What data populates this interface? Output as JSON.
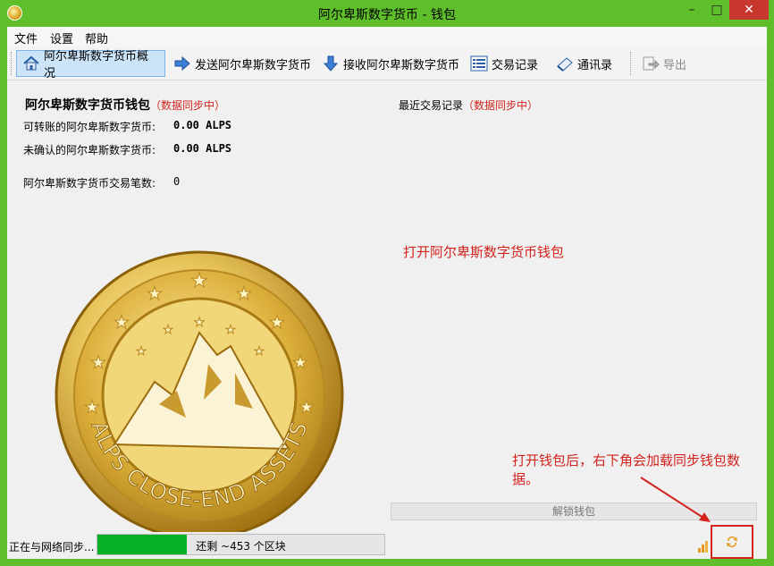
{
  "window": {
    "title": "阿尔卑斯数字货币 - 钱包",
    "min": "–",
    "max": "□",
    "close": "✕"
  },
  "menu": [
    "文件",
    "设置",
    "帮助"
  ],
  "toolbar": {
    "overview": "阿尔卑斯数字货币概况",
    "send": "发送阿尔卑斯数字货币",
    "receive": "接收阿尔卑斯数字货币",
    "transactions": "交易记录",
    "addressbook": "通讯录",
    "export": "导出"
  },
  "wallet": {
    "title": "阿尔卑斯数字货币钱包",
    "syncing": "（数据同步中）",
    "available_label": "可转账的阿尔卑斯数字货币:",
    "available_value": "0.00 ALPS",
    "unconfirmed_label": "未确认的阿尔卑斯数字货币:",
    "unconfirmed_value": "0.00 ALPS",
    "txcount_label": "阿尔卑斯数字货币交易笔数:",
    "txcount_value": "0"
  },
  "recent": {
    "label": "最近交易记录",
    "syncing": "（数据同步中）"
  },
  "notes": {
    "open": "打开阿尔卑斯数字货币钱包",
    "after": "打开钱包后，右下角会加载同步钱包数据。"
  },
  "unlock_label": "解锁钱包",
  "coin_text": "ALPS CLOSE-END ASSETS",
  "status": {
    "text": "正在与网络同步...",
    "progress_text": "还剩 ~453 个区块",
    "progress_fraction": 0.31
  },
  "colors": {
    "window_frame": "#5fbf2a",
    "accent_red": "#d2231e",
    "progress": "#06b025"
  },
  "icons": [
    "home-icon",
    "send-arrow-icon",
    "receive-arrow-icon",
    "list-icon",
    "addressbook-icon",
    "export-icon",
    "signal-icon",
    "sync-icon"
  ]
}
